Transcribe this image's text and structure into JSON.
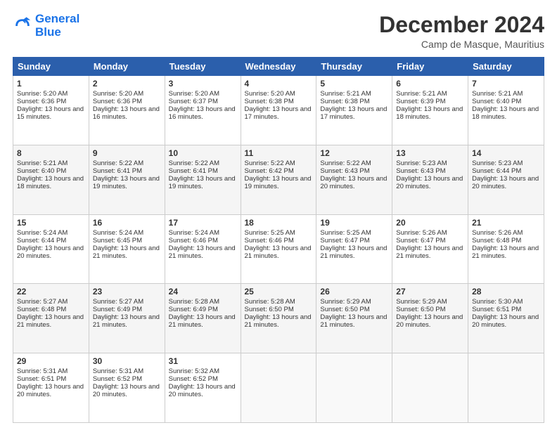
{
  "logo": {
    "line1": "General",
    "line2": "Blue"
  },
  "title": "December 2024",
  "subtitle": "Camp de Masque, Mauritius",
  "days_of_week": [
    "Sunday",
    "Monday",
    "Tuesday",
    "Wednesday",
    "Thursday",
    "Friday",
    "Saturday"
  ],
  "weeks": [
    [
      {
        "day": "1",
        "sunrise": "5:20 AM",
        "sunset": "6:36 PM",
        "daylight": "13 hours and 15 minutes."
      },
      {
        "day": "2",
        "sunrise": "5:20 AM",
        "sunset": "6:36 PM",
        "daylight": "13 hours and 16 minutes."
      },
      {
        "day": "3",
        "sunrise": "5:20 AM",
        "sunset": "6:37 PM",
        "daylight": "13 hours and 16 minutes."
      },
      {
        "day": "4",
        "sunrise": "5:20 AM",
        "sunset": "6:38 PM",
        "daylight": "13 hours and 17 minutes."
      },
      {
        "day": "5",
        "sunrise": "5:21 AM",
        "sunset": "6:38 PM",
        "daylight": "13 hours and 17 minutes."
      },
      {
        "day": "6",
        "sunrise": "5:21 AM",
        "sunset": "6:39 PM",
        "daylight": "13 hours and 18 minutes."
      },
      {
        "day": "7",
        "sunrise": "5:21 AM",
        "sunset": "6:40 PM",
        "daylight": "13 hours and 18 minutes."
      }
    ],
    [
      {
        "day": "8",
        "sunrise": "5:21 AM",
        "sunset": "6:40 PM",
        "daylight": "13 hours and 18 minutes."
      },
      {
        "day": "9",
        "sunrise": "5:22 AM",
        "sunset": "6:41 PM",
        "daylight": "13 hours and 19 minutes."
      },
      {
        "day": "10",
        "sunrise": "5:22 AM",
        "sunset": "6:41 PM",
        "daylight": "13 hours and 19 minutes."
      },
      {
        "day": "11",
        "sunrise": "5:22 AM",
        "sunset": "6:42 PM",
        "daylight": "13 hours and 19 minutes."
      },
      {
        "day": "12",
        "sunrise": "5:22 AM",
        "sunset": "6:43 PM",
        "daylight": "13 hours and 20 minutes."
      },
      {
        "day": "13",
        "sunrise": "5:23 AM",
        "sunset": "6:43 PM",
        "daylight": "13 hours and 20 minutes."
      },
      {
        "day": "14",
        "sunrise": "5:23 AM",
        "sunset": "6:44 PM",
        "daylight": "13 hours and 20 minutes."
      }
    ],
    [
      {
        "day": "15",
        "sunrise": "5:24 AM",
        "sunset": "6:44 PM",
        "daylight": "13 hours and 20 minutes."
      },
      {
        "day": "16",
        "sunrise": "5:24 AM",
        "sunset": "6:45 PM",
        "daylight": "13 hours and 21 minutes."
      },
      {
        "day": "17",
        "sunrise": "5:24 AM",
        "sunset": "6:46 PM",
        "daylight": "13 hours and 21 minutes."
      },
      {
        "day": "18",
        "sunrise": "5:25 AM",
        "sunset": "6:46 PM",
        "daylight": "13 hours and 21 minutes."
      },
      {
        "day": "19",
        "sunrise": "5:25 AM",
        "sunset": "6:47 PM",
        "daylight": "13 hours and 21 minutes."
      },
      {
        "day": "20",
        "sunrise": "5:26 AM",
        "sunset": "6:47 PM",
        "daylight": "13 hours and 21 minutes."
      },
      {
        "day": "21",
        "sunrise": "5:26 AM",
        "sunset": "6:48 PM",
        "daylight": "13 hours and 21 minutes."
      }
    ],
    [
      {
        "day": "22",
        "sunrise": "5:27 AM",
        "sunset": "6:48 PM",
        "daylight": "13 hours and 21 minutes."
      },
      {
        "day": "23",
        "sunrise": "5:27 AM",
        "sunset": "6:49 PM",
        "daylight": "13 hours and 21 minutes."
      },
      {
        "day": "24",
        "sunrise": "5:28 AM",
        "sunset": "6:49 PM",
        "daylight": "13 hours and 21 minutes."
      },
      {
        "day": "25",
        "sunrise": "5:28 AM",
        "sunset": "6:50 PM",
        "daylight": "13 hours and 21 minutes."
      },
      {
        "day": "26",
        "sunrise": "5:29 AM",
        "sunset": "6:50 PM",
        "daylight": "13 hours and 21 minutes."
      },
      {
        "day": "27",
        "sunrise": "5:29 AM",
        "sunset": "6:50 PM",
        "daylight": "13 hours and 20 minutes."
      },
      {
        "day": "28",
        "sunrise": "5:30 AM",
        "sunset": "6:51 PM",
        "daylight": "13 hours and 20 minutes."
      }
    ],
    [
      {
        "day": "29",
        "sunrise": "5:31 AM",
        "sunset": "6:51 PM",
        "daylight": "13 hours and 20 minutes."
      },
      {
        "day": "30",
        "sunrise": "5:31 AM",
        "sunset": "6:52 PM",
        "daylight": "13 hours and 20 minutes."
      },
      {
        "day": "31",
        "sunrise": "5:32 AM",
        "sunset": "6:52 PM",
        "daylight": "13 hours and 20 minutes."
      },
      null,
      null,
      null,
      null
    ]
  ]
}
